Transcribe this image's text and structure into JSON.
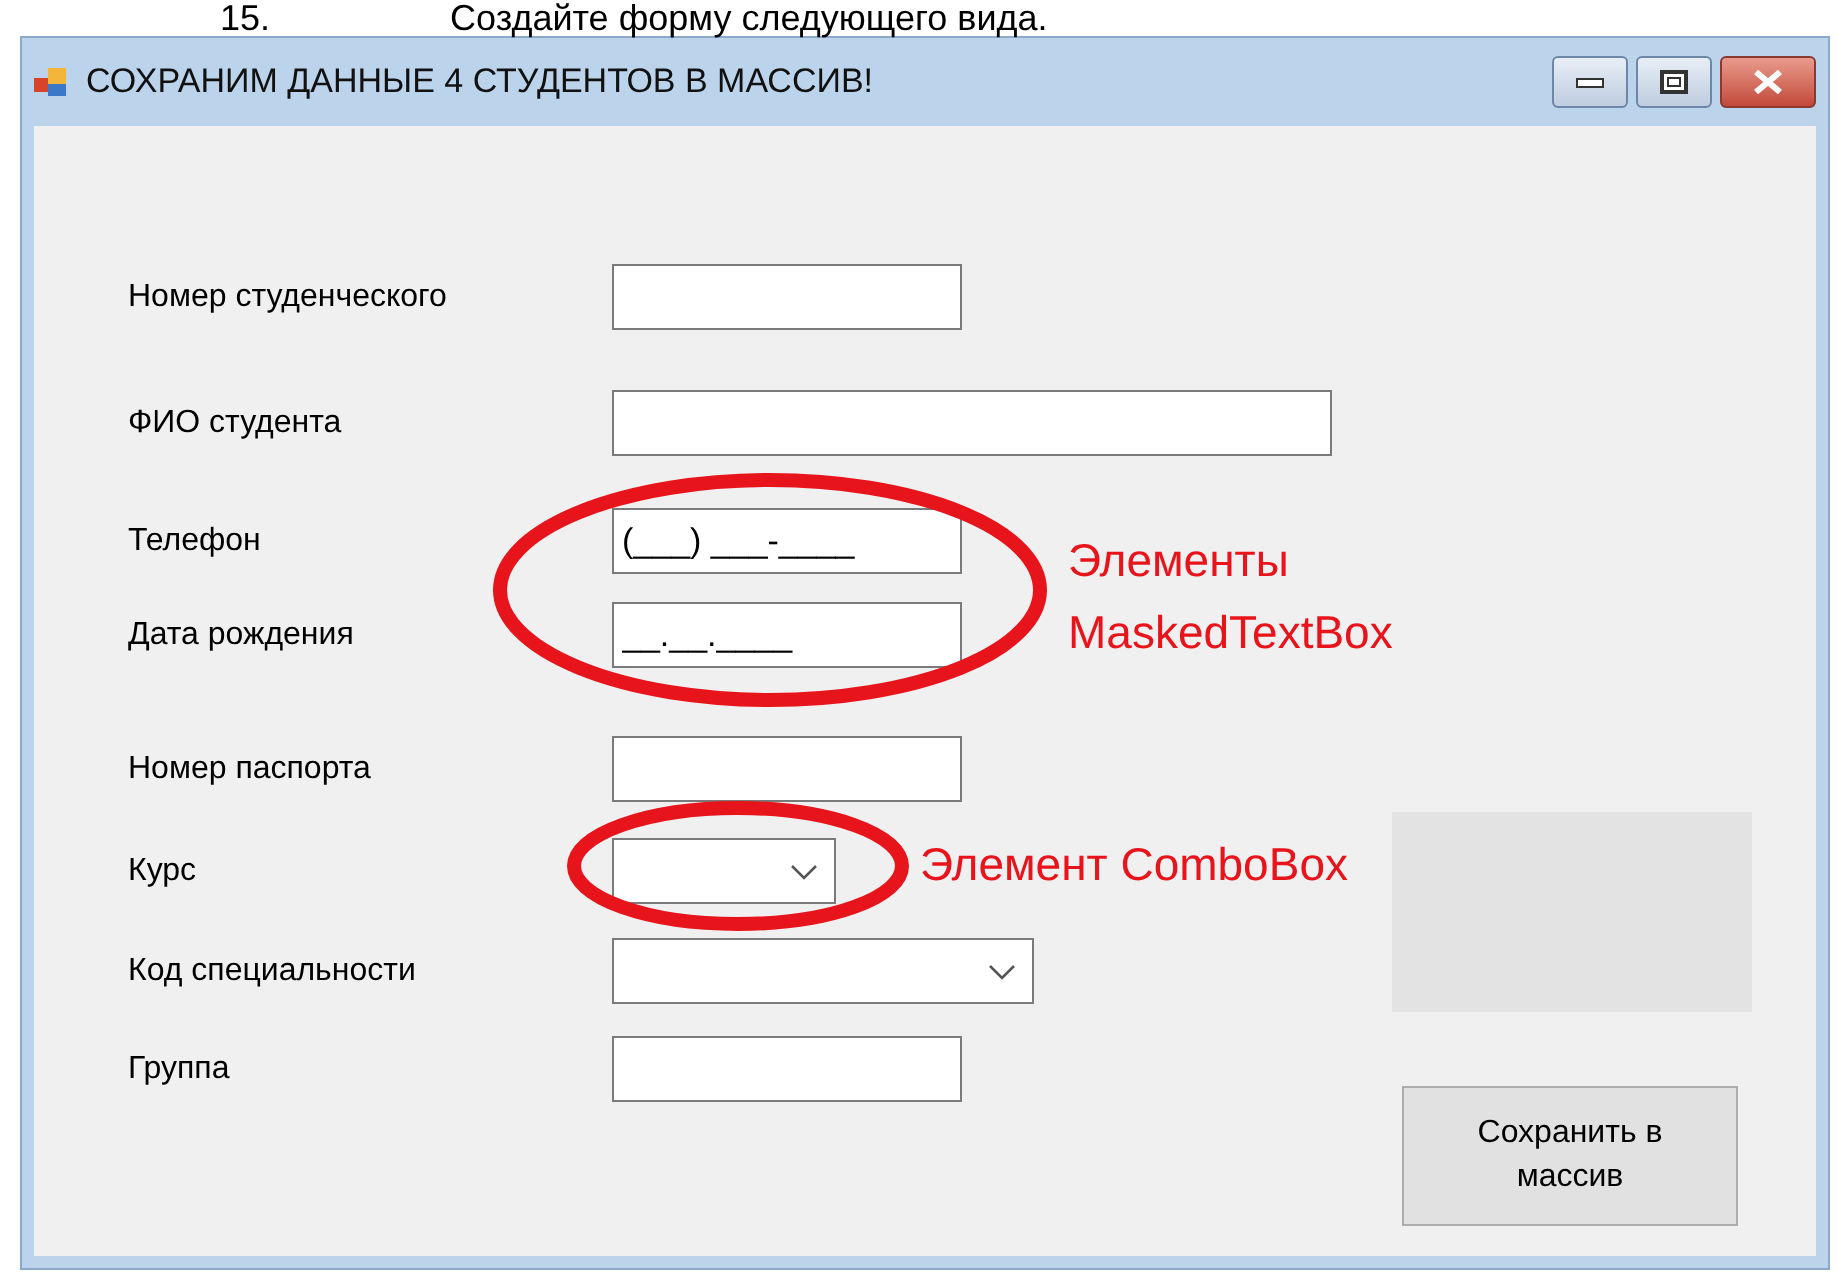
{
  "document_heading": {
    "number": "15.",
    "text": "Создайте форму следующего вида."
  },
  "window": {
    "title": "СОХРАНИМ ДАННЫЕ 4 СТУДЕНТОВ В МАССИВ!"
  },
  "fields": [
    {
      "label": "Номер студенческого",
      "kind": "text"
    },
    {
      "label": "ФИО студента",
      "kind": "text"
    },
    {
      "label": "Телефон",
      "kind": "masked",
      "value": "(___) ___-____"
    },
    {
      "label": "Дата рождения",
      "kind": "masked",
      "value": "__.__.____"
    },
    {
      "label": "Номер паспорта",
      "kind": "text"
    },
    {
      "label": "Курс",
      "kind": "combo"
    },
    {
      "label": "Код специальности",
      "kind": "combo"
    },
    {
      "label": "Группа",
      "kind": "text"
    }
  ],
  "save_button": {
    "label": "Сохранить в массив"
  },
  "annotations": [
    {
      "text": "Элементы MaskedTextBox",
      "kind": "masked"
    },
    {
      "text": "Элемент ComboBox",
      "kind": "combo"
    }
  ]
}
